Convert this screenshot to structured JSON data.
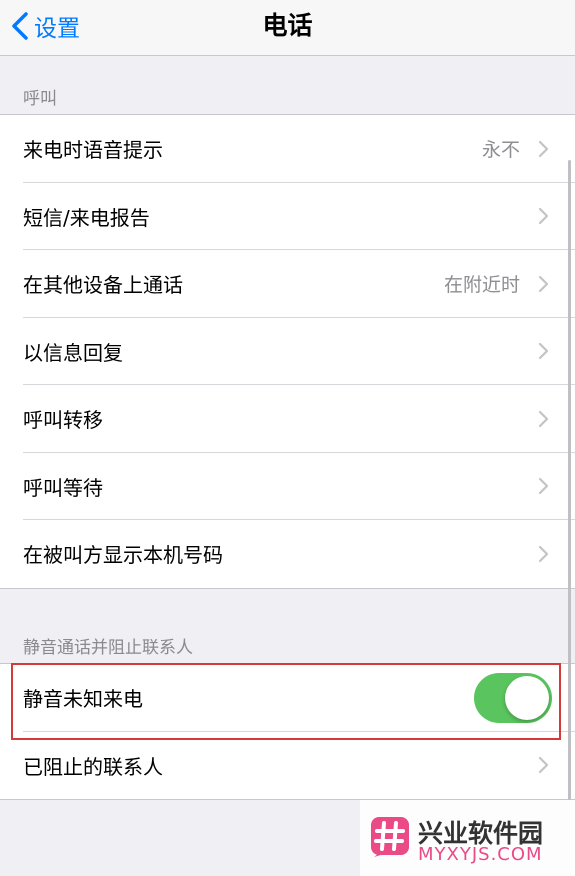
{
  "nav": {
    "back_label": "设置",
    "title": "电话"
  },
  "sections": [
    {
      "header": "呼叫",
      "rows": [
        {
          "label": "来电时语音提示",
          "value": "永不"
        },
        {
          "label": "短信/来电报告",
          "value": ""
        },
        {
          "label": "在其他设备上通话",
          "value": "在附近时"
        },
        {
          "label": "以信息回复",
          "value": ""
        },
        {
          "label": "呼叫转移",
          "value": ""
        },
        {
          "label": "呼叫等待",
          "value": ""
        },
        {
          "label": "在被叫方显示本机号码",
          "value": ""
        }
      ]
    },
    {
      "header": "静音通话并阻止联系人",
      "rows": [
        {
          "label": "静音未知来电",
          "toggle_on": true
        },
        {
          "label": "已阻止的联系人",
          "value": ""
        }
      ]
    }
  ],
  "watermark": {
    "name": "兴业软件园",
    "url": "MYXYJS.COM"
  },
  "colors": {
    "accent": "#007aff",
    "toggle_on": "#5ac55e",
    "highlight": "#d33a3a"
  }
}
